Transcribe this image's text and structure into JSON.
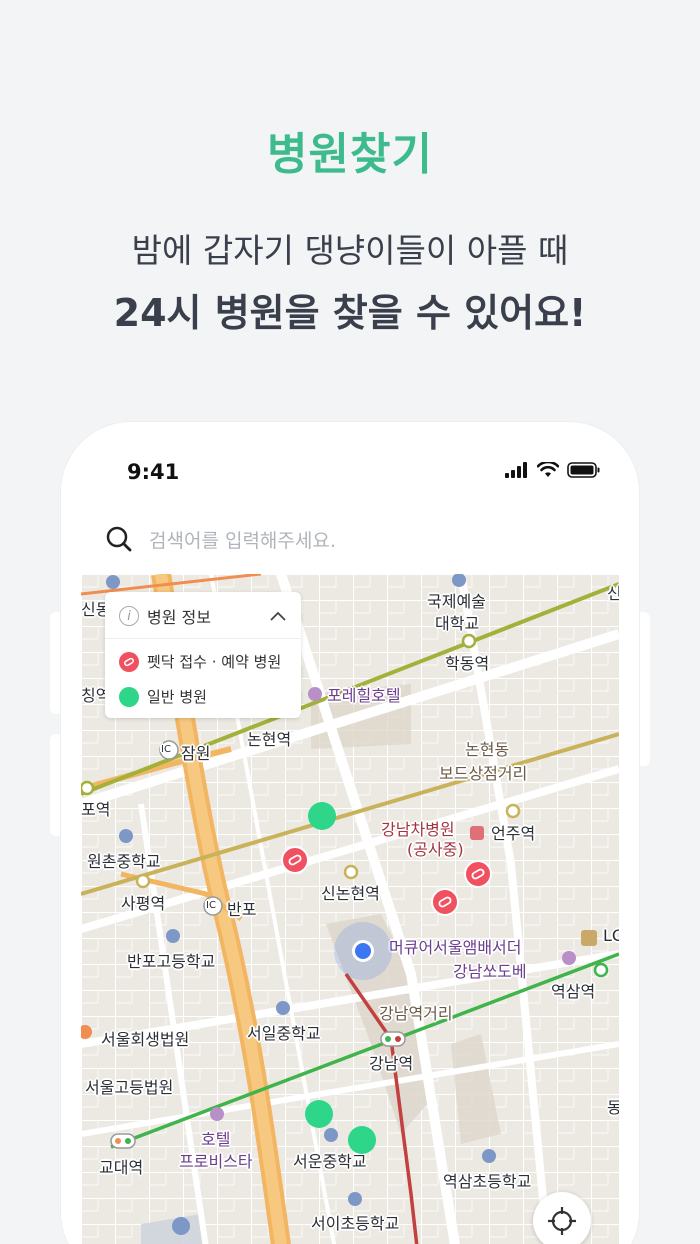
{
  "hero": {
    "title": "병원찾기",
    "subtitle": "밤에 갑자기 댕냥이들이 아플 때",
    "headline": "24시 병원을 찾을 수 있어요!"
  },
  "status": {
    "time": "9:41"
  },
  "search": {
    "placeholder": "검색어를 입력해주세요."
  },
  "legend": {
    "title": "병원 정보",
    "items": [
      {
        "label": "펫닥 접수 · 예약 병원",
        "color": "#f15060"
      },
      {
        "label": "일반 병원",
        "color": "#2ed68a"
      }
    ]
  },
  "map": {
    "labels": {
      "gukje1": "국제예술",
      "gukje2": "대학교",
      "hakdong": "학동역",
      "sindong": "신동",
      "porehill": "포레힐호텔",
      "nonhyeon": "논현역",
      "jamwon": "잠원",
      "nonhyeondong": "논현동",
      "bodeu": "보드상점거리",
      "po": "포역",
      "gangnamcha": "강남차병원",
      "gongsa": "(공사중)",
      "eonju": "언주역",
      "wonchon": "원촌중학교",
      "sapyeong": "사평역",
      "banpo": "반포",
      "sinnonhyeon": "신논현역",
      "banpohigh": "반포고등학교",
      "mercure": "머큐어서울앰배서더",
      "gangnamsofitel": "강남쏘도베",
      "yeoksam": "역삼역",
      "gangnamgeori": "강남역거리",
      "seoulrehab": "서울회생법원",
      "seoilmiddle": "서일중학교",
      "gangnam": "강남역",
      "seoulhigh": "서울고등법원",
      "hotel": "호텔",
      "provista": "프로비스타",
      "seoun": "서운중학교",
      "gyodae": "교대역",
      "yeoksamelem": "역삼초등학교",
      "seoielem": "서이초등학교",
      "ic1": "IC",
      "ic2": "IC",
      "lc": "LC",
      "dong": "동",
      "sin": "신",
      "sinkeo": "칭역"
    }
  }
}
